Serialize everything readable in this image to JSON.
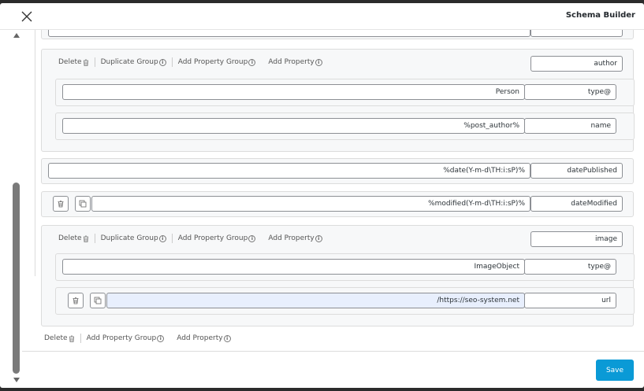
{
  "modal": {
    "title": "Schema Builder"
  },
  "actions": {
    "delete": "Delete",
    "duplicate_group": "Duplicate Group",
    "add_property_group": "Add Property Group",
    "add_property": "Add Property"
  },
  "rows": {
    "author_key": "author",
    "author_type_value": "Person",
    "author_type_key": "type@",
    "author_name_value": "%post_author%",
    "author_name_key": "name",
    "date_published_value": "%date(Y-m-d\\TH:i:sP)%",
    "date_published_key": "datePublished",
    "date_modified_value": "%modified(Y-m-d\\TH:i:sP)%",
    "date_modified_key": "dateModified",
    "image_key": "image",
    "image_type_value": "ImageObject",
    "image_type_key": "type@",
    "image_url_value": "/https://seo-system.net",
    "image_url_key": "url"
  },
  "footer": {
    "save_label": "Save"
  },
  "colors": {
    "accent": "#0a9ad6",
    "focused_input": "#e8effd"
  }
}
